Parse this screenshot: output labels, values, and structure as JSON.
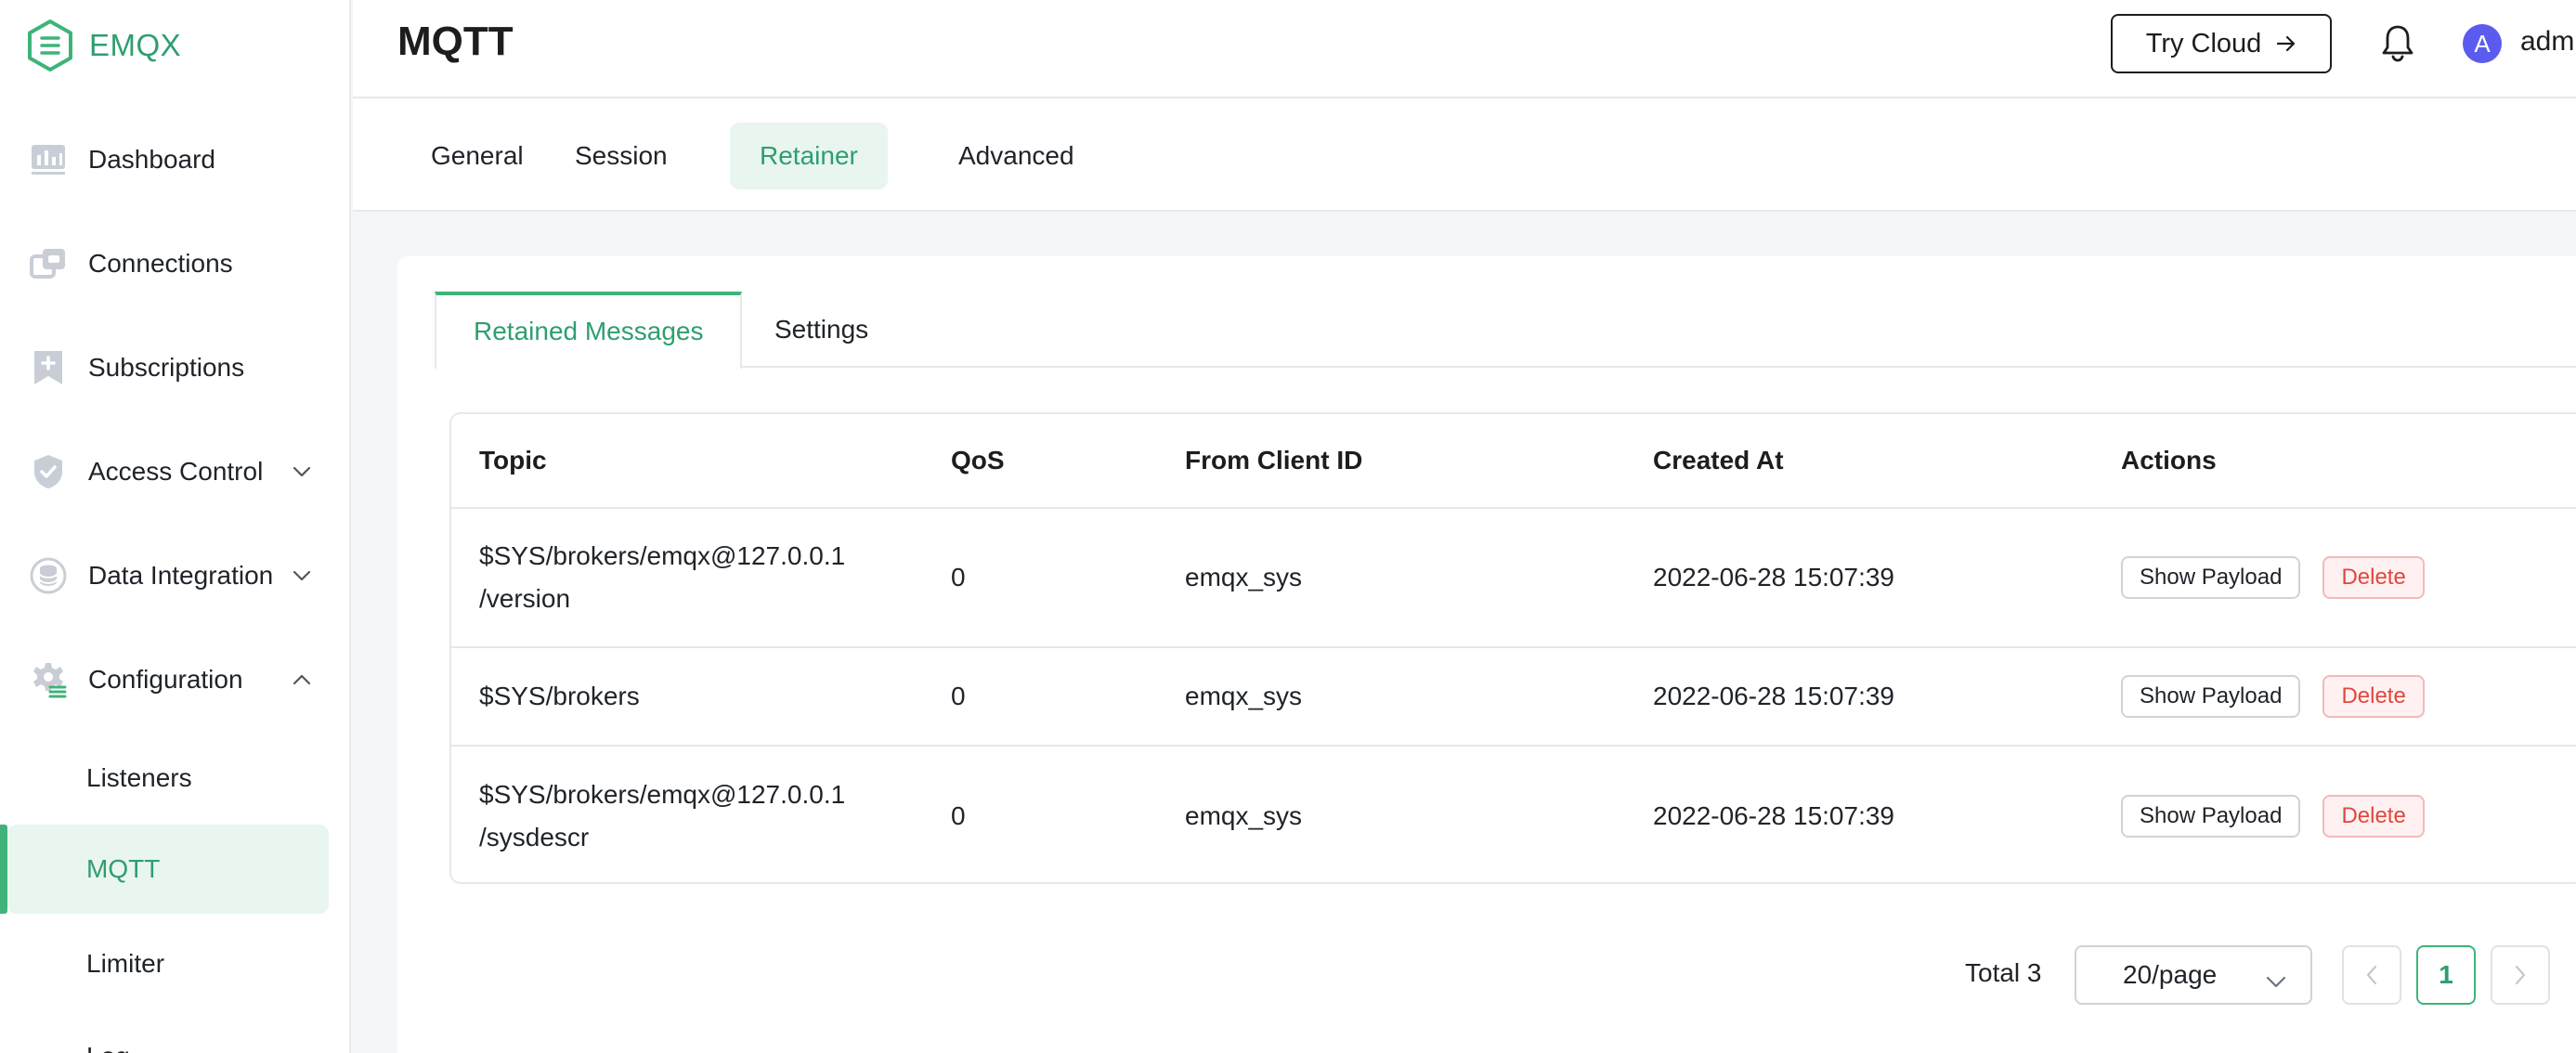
{
  "app": {
    "brand": "EMQX",
    "accent": "#3fb37a"
  },
  "sidebar": {
    "items": [
      {
        "label": "Dashboard",
        "icon": "dashboard-icon"
      },
      {
        "label": "Connections",
        "icon": "connections-icon"
      },
      {
        "label": "Subscriptions",
        "icon": "subscriptions-icon"
      },
      {
        "label": "Access Control",
        "icon": "shield-icon",
        "expandable": true
      },
      {
        "label": "Data Integration",
        "icon": "database-icon",
        "expandable": true
      },
      {
        "label": "Configuration",
        "icon": "gear-icon",
        "expandable": true,
        "expanded": true
      }
    ],
    "sub_items": [
      {
        "label": "Listeners"
      },
      {
        "label": "MQTT",
        "active": true
      },
      {
        "label": "Limiter"
      },
      {
        "label": "Log"
      }
    ]
  },
  "header": {
    "title": "MQTT",
    "try_cloud": "Try Cloud",
    "avatar_letter": "A",
    "username": "admin"
  },
  "top_tabs": [
    {
      "label": "General"
    },
    {
      "label": "Session"
    },
    {
      "label": "Retainer",
      "active": true
    },
    {
      "label": "Advanced"
    }
  ],
  "inner_tabs": [
    {
      "label": "Retained Messages",
      "active": true
    },
    {
      "label": "Settings"
    }
  ],
  "table": {
    "columns": [
      "Topic",
      "QoS",
      "From Client ID",
      "Created At",
      "Actions"
    ],
    "rows": [
      {
        "topic_line1": "$SYS/brokers/emqx@127.0.0.1",
        "topic_line2": "/version",
        "qos": "0",
        "client": "emqx_sys",
        "created": "2022-06-28 15:07:39"
      },
      {
        "topic_line1": "$SYS/brokers",
        "topic_line2": "",
        "qos": "0",
        "client": "emqx_sys",
        "created": "2022-06-28 15:07:39"
      },
      {
        "topic_line1": "$SYS/brokers/emqx@127.0.0.1",
        "topic_line2": "/sysdescr",
        "qos": "0",
        "client": "emqx_sys",
        "created": "2022-06-28 15:07:39"
      }
    ],
    "show_payload_label": "Show Payload",
    "delete_label": "Delete"
  },
  "pagination": {
    "total": "Total 3",
    "page_size": "20/page",
    "current_page": "1"
  }
}
